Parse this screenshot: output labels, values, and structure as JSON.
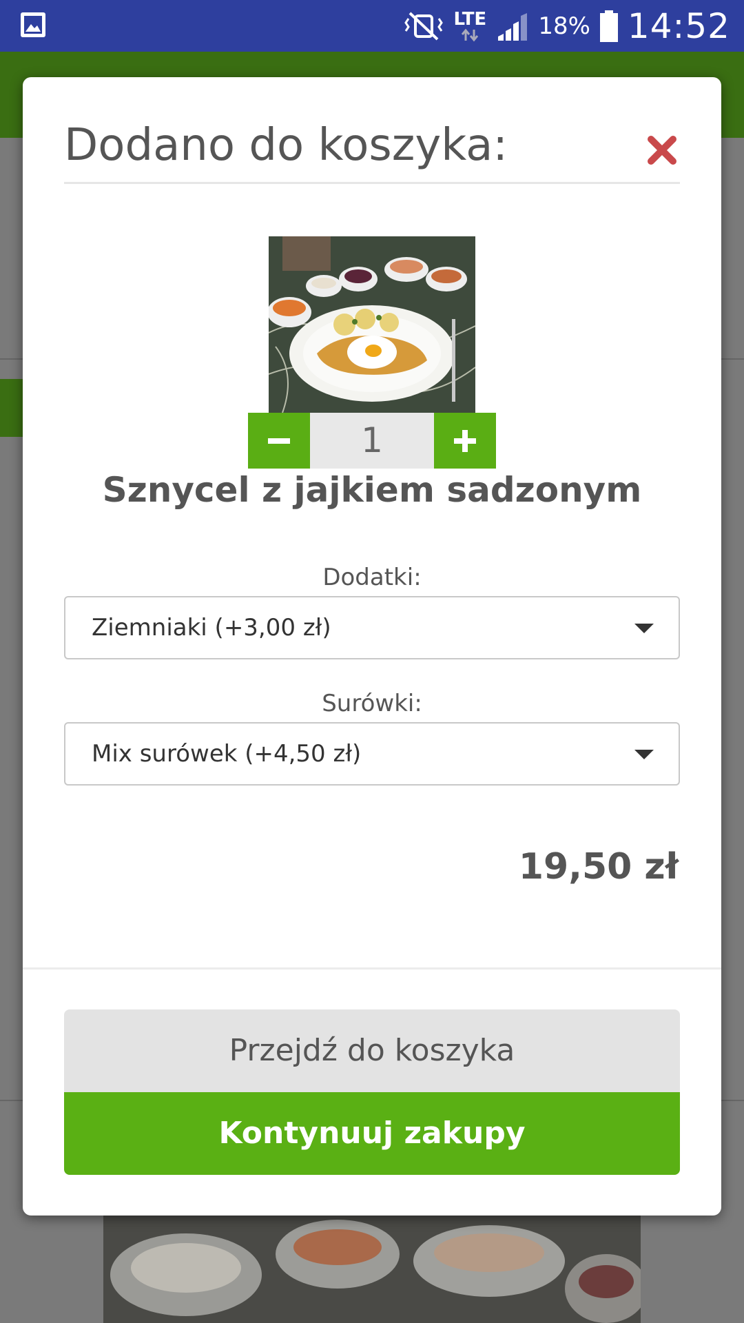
{
  "status_bar": {
    "network": "LTE",
    "battery": "18%",
    "time": "14:52",
    "icons": [
      "gallery-icon",
      "mute-icon",
      "signal-icon",
      "battery-icon"
    ]
  },
  "dialog": {
    "title": "Dodano do koszyka:",
    "close_icon": "close-icon",
    "product": {
      "image": "schnitzel-with-fried-egg-photo",
      "name": "Sznycel z jajkiem sadzonym",
      "quantity": "1"
    },
    "addons_label": "Dodatki:",
    "addons_value": "Ziemniaki (+3,00 zł)",
    "salads_label": "Surówki:",
    "salads_value": "Mix surówek (+4,50 zł)",
    "total": "19,50 zł",
    "go_to_cart": "Przejdź do koszyka",
    "continue_shopping": "Kontynuuj zakupy"
  },
  "colors": {
    "status_bar": "#2e3f9e",
    "accent_green": "#5ab014",
    "close_red": "#c9494b"
  }
}
